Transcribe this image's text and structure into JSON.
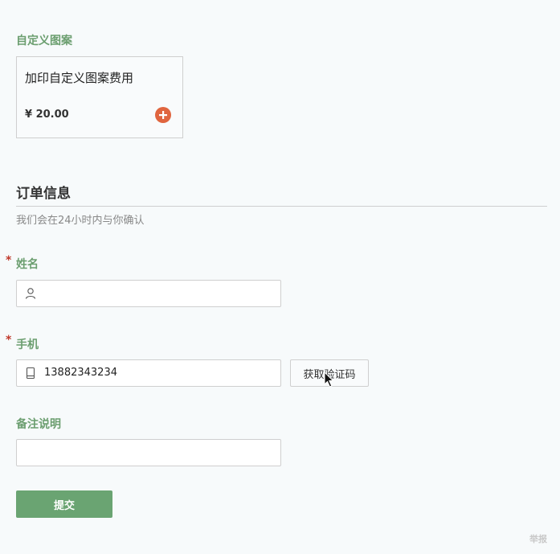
{
  "custom_pattern": {
    "section_title": "自定义图案",
    "product_name": "加印自定义图案费用",
    "price": "¥ 20.00",
    "add_icon": "plus-circle-icon",
    "accent_color": "#e0653f"
  },
  "order_info": {
    "title": "订单信息",
    "subtitle": "我们会在24小时内与你确认"
  },
  "fields": {
    "required_mark": "*",
    "name_label": "姓名",
    "name_value": "",
    "name_icon": "user-icon",
    "phone_label": "手机",
    "phone_value": "13882343234",
    "phone_icon": "phone-icon",
    "get_code_label": "获取验证码",
    "notes_label": "备注说明",
    "notes_value": ""
  },
  "submit_label": "提交",
  "report_label": "举报",
  "colors": {
    "brand_green": "#6aa472",
    "label_green": "#6b9e6f",
    "required_red": "#c0392b"
  }
}
